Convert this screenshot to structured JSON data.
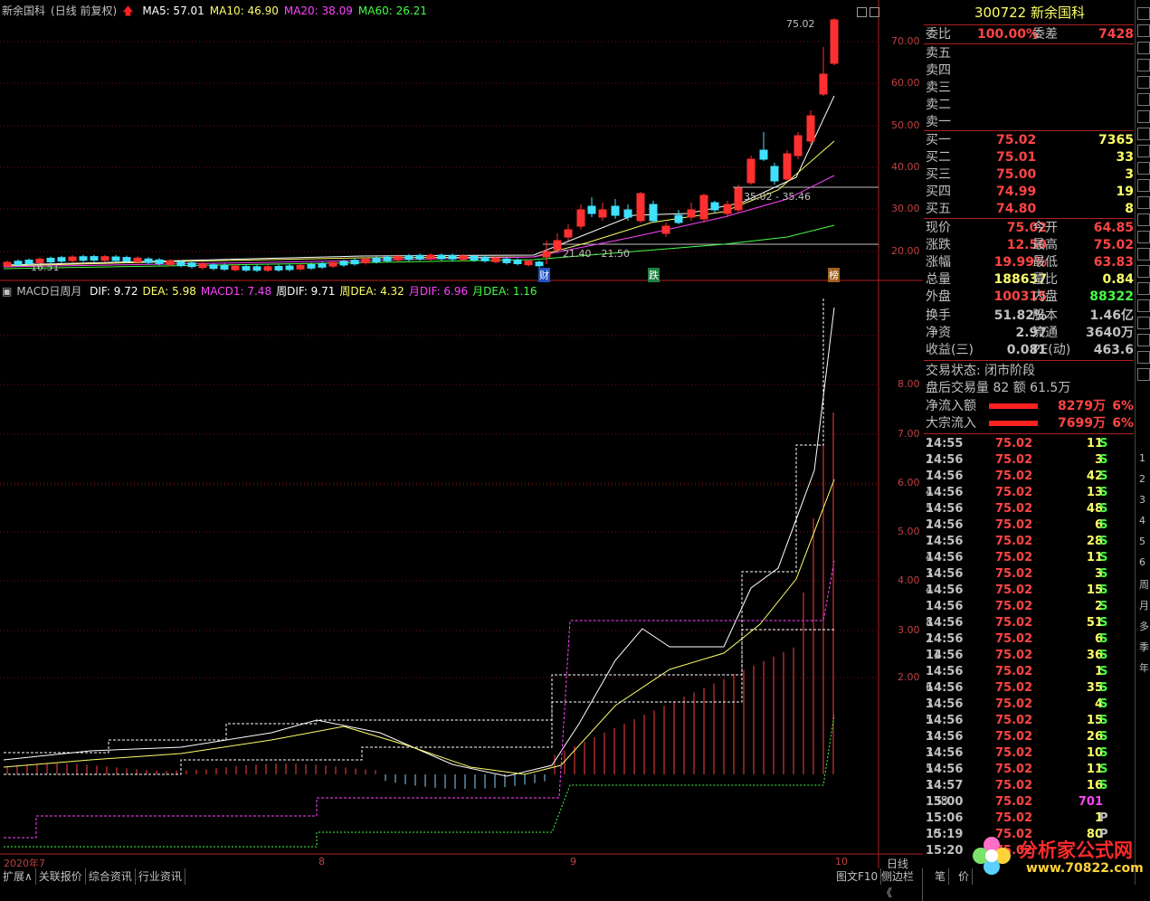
{
  "header": {
    "stock_name": "新余国科",
    "period": "(日线 前复权)",
    "ma": [
      {
        "label": "MA5: 57.01",
        "color": "#ffffff"
      },
      {
        "label": "MA10: 46.90",
        "color": "#ffff66"
      },
      {
        "label": "MA20: 38.09",
        "color": "#ff44ff"
      },
      {
        "label": "MA60: 26.21",
        "color": "#44ff44"
      }
    ]
  },
  "indicator": {
    "name": "MACD日周月",
    "items": [
      {
        "label": "DIF: 9.72",
        "color": "#ffffff"
      },
      {
        "label": "DEA: 5.98",
        "color": "#ffff66"
      },
      {
        "label": "MACD1: 7.48",
        "color": "#ff44ff"
      },
      {
        "label": "周DIF: 9.71",
        "color": "#ffffff"
      },
      {
        "label": "周DEA: 4.32",
        "color": "#ffff66"
      },
      {
        "label": "月DIF: 6.96",
        "color": "#ff44ff"
      },
      {
        "label": "月DEA: 1.16",
        "color": "#44ff44"
      }
    ]
  },
  "price_axis": [
    "70.00",
    "60.00",
    "50.00",
    "40.00",
    "30.00",
    "20.00"
  ],
  "macd_axis": [
    "8.00",
    "7.00",
    "6.00",
    "5.00",
    "4.00",
    "3.00",
    "2.00"
  ],
  "annotations": {
    "high": "75.02",
    "mid": "35.02 - 35.46",
    "low": "21.40 - 21.50",
    "start": "16.51",
    "marks": [
      "财",
      "跌",
      "榜"
    ]
  },
  "date_axis": [
    "2020年7",
    "8",
    "9",
    "10"
  ],
  "period_label": "日线",
  "toolbar": {
    "left": [
      "扩展∧",
      "关联报价",
      "综合资讯",
      "行业资讯"
    ],
    "right": [
      "图文F10",
      "侧边栏《",
      "笔",
      "价"
    ]
  },
  "quote": {
    "code": "300722",
    "name": "新余国科",
    "webi_label": "委比",
    "webi_value": "100.00%",
    "weicha_label": "委差",
    "weicha_value": "7428",
    "sells": [
      "卖五",
      "卖四",
      "卖三",
      "卖二",
      "卖一"
    ],
    "buys": [
      {
        "label": "买一",
        "price": "75.02",
        "vol": "7365"
      },
      {
        "label": "买二",
        "price": "75.01",
        "vol": "33"
      },
      {
        "label": "买三",
        "price": "75.00",
        "vol": "3"
      },
      {
        "label": "买四",
        "price": "74.99",
        "vol": "19"
      },
      {
        "label": "买五",
        "price": "74.80",
        "vol": "8"
      }
    ],
    "stats": [
      {
        "l1": "现价",
        "v1": "75.02",
        "c1": "#ff4444",
        "l2": "今开",
        "v2": "64.85",
        "c2": "#ff4444"
      },
      {
        "l1": "涨跌",
        "v1": "12.50",
        "c1": "#ff4444",
        "l2": "最高",
        "v2": "75.02",
        "c2": "#ff4444"
      },
      {
        "l1": "涨幅",
        "v1": "19.99%",
        "c1": "#ff4444",
        "l2": "最低",
        "v2": "63.83",
        "c2": "#ff4444"
      },
      {
        "l1": "总量",
        "v1": "188637",
        "c1": "#ffff66",
        "l2": "量比",
        "v2": "0.84",
        "c2": "#ffff66"
      },
      {
        "l1": "外盘",
        "v1": "100315",
        "c1": "#ff4444",
        "l2": "内盘",
        "v2": "88322",
        "c2": "#44ff44"
      },
      {
        "l1": "换手",
        "v1": "51.82%",
        "c1": "#c0c0c0",
        "l2": "股本",
        "v2": "1.46亿",
        "c2": "#c0c0c0"
      },
      {
        "l1": "净资",
        "v1": "2.97",
        "c1": "#c0c0c0",
        "l2": "流通",
        "v2": "3640万",
        "c2": "#c0c0c0"
      },
      {
        "l1": "收益(三)",
        "v1": "0.081",
        "c1": "#c0c0c0",
        "l2": "PE(动)",
        "v2": "463.6",
        "c2": "#c0c0c0"
      }
    ],
    "status": "交易状态: 闭市阶段",
    "after_hours": "盘后交易量 82 额 61.5万",
    "flows": [
      {
        "label": "净流入额",
        "value": "8279万",
        "pct": "6%"
      },
      {
        "label": "大宗流入",
        "value": "7699万",
        "pct": "6%"
      }
    ]
  },
  "ticks": [
    {
      "t": "14:55",
      "p": "75.02",
      "v": "11",
      "s": "S",
      "n": "2"
    },
    {
      "t": "14:56",
      "p": "75.02",
      "v": "3",
      "s": "S",
      "n": "2"
    },
    {
      "t": "14:56",
      "p": "75.02",
      "v": "42",
      "s": "S",
      "n": "7"
    },
    {
      "t": "14:56",
      "p": "75.02",
      "v": "13",
      "s": "S",
      "n": "4"
    },
    {
      "t": "14:56",
      "p": "75.02",
      "v": "48",
      "s": "S",
      "n": "5"
    },
    {
      "t": "14:56",
      "p": "75.02",
      "v": "6",
      "s": "S",
      "n": "2"
    },
    {
      "t": "14:56",
      "p": "75.02",
      "v": "28",
      "s": "S",
      "n": "7"
    },
    {
      "t": "14:56",
      "p": "75.02",
      "v": "11",
      "s": "S",
      "n": "4"
    },
    {
      "t": "14:56",
      "p": "75.02",
      "v": "3",
      "s": "S",
      "n": "3"
    },
    {
      "t": "14:56",
      "p": "75.02",
      "v": "15",
      "s": "S",
      "n": "4"
    },
    {
      "t": "14:56",
      "p": "75.02",
      "v": "2",
      "s": "S",
      "n": "1"
    },
    {
      "t": "14:56",
      "p": "75.02",
      "v": "51",
      "s": "S",
      "n": "8"
    },
    {
      "t": "14:56",
      "p": "75.02",
      "v": "6",
      "s": "S",
      "n": "2"
    },
    {
      "t": "14:56",
      "p": "75.02",
      "v": "36",
      "s": "S",
      "n": "11"
    },
    {
      "t": "14:56",
      "p": "75.02",
      "v": "1",
      "s": "S",
      "n": "1"
    },
    {
      "t": "14:56",
      "p": "75.02",
      "v": "35",
      "s": "S",
      "n": "6"
    },
    {
      "t": "14:56",
      "p": "75.02",
      "v": "4",
      "s": "S",
      "n": "3"
    },
    {
      "t": "14:56",
      "p": "75.02",
      "v": "15",
      "s": "S",
      "n": "5"
    },
    {
      "t": "14:56",
      "p": "75.02",
      "v": "26",
      "s": "S",
      "n": "3"
    },
    {
      "t": "14:56",
      "p": "75.02",
      "v": "10",
      "s": "S",
      "n": "3"
    },
    {
      "t": "14:56",
      "p": "75.02",
      "v": "11",
      "s": "S",
      "n": "5"
    },
    {
      "t": "14:57",
      "p": "75.02",
      "v": "16",
      "s": "S",
      "n": "3"
    },
    {
      "t": "15:00",
      "p": "75.02",
      "v": "701",
      "s": "",
      "n": "138",
      "vc": "#ff44ff"
    },
    {
      "t": "15:06",
      "p": "75.02",
      "v": "1",
      "s": "P",
      "n": "1"
    },
    {
      "t": "15:19",
      "p": "75.02",
      "v": "80",
      "s": "P",
      "n": "10"
    },
    {
      "t": "15:20",
      "p": "75.02",
      "v": "",
      "s": "",
      "n": ""
    }
  ],
  "side_labels": [
    "1",
    "2",
    "3",
    "4",
    "5",
    "6",
    "周",
    "月",
    "多",
    "季",
    "年"
  ],
  "logo": {
    "text": "分析家公式网",
    "url": "www.70822.com"
  }
}
